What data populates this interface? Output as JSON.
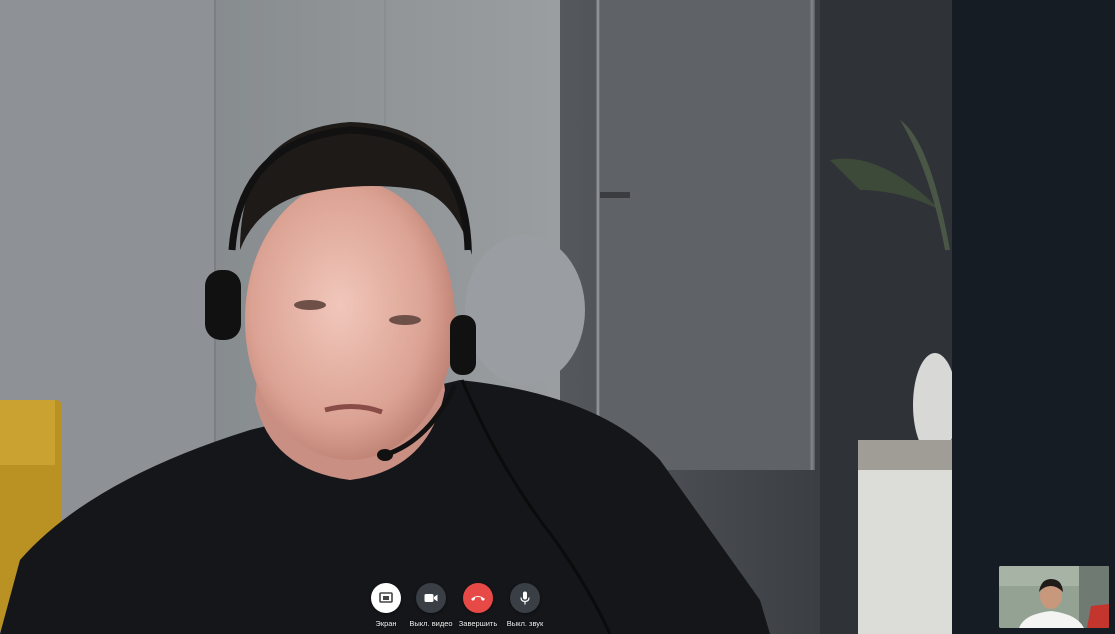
{
  "controls": {
    "screen_label": "Экран",
    "video_off_label": "Выкл. видео",
    "end_call_label": "Завершить",
    "audio_off_label": "Выкл. звук"
  },
  "colors": {
    "screen_button": "#ffffff",
    "video_button": "#3a3f45",
    "end_call_button": "#e74a46",
    "audio_button": "#3a3f45",
    "side_panel": "#161c24"
  },
  "icons": {
    "screen": "screen-share-icon",
    "video": "video-camera-icon",
    "end_call": "phone-hangup-icon",
    "audio": "microphone-icon"
  }
}
